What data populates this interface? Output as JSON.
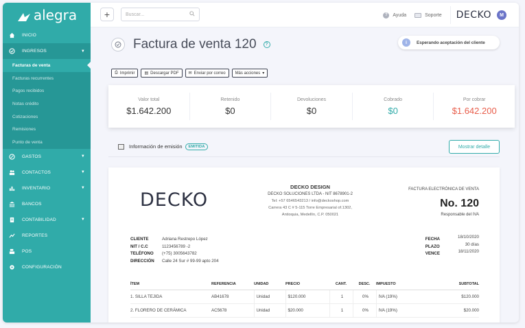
{
  "sidebar": {
    "logo": "alegra",
    "items": [
      {
        "label": "INICIO"
      },
      {
        "label": "INGRESOS"
      },
      {
        "label": "GASTOS"
      },
      {
        "label": "CONTACTOS"
      },
      {
        "label": "INVENTARIO"
      },
      {
        "label": "BANCOS"
      },
      {
        "label": "CONTABILIDAD"
      },
      {
        "label": "REPORTES"
      },
      {
        "label": "POS"
      },
      {
        "label": "CONFIGURACIÓN"
      }
    ],
    "ingresos_sub": [
      "Facturas de venta",
      "Facturas recurrentes",
      "Pagos recibidos",
      "Notas crédito",
      "Cotizaciones",
      "Remisiones",
      "Punto de venta"
    ]
  },
  "topbar": {
    "search_placeholder": "Buscar...",
    "help": "Ayuda",
    "support": "Soporte",
    "brand": "DECKO",
    "avatar": "M"
  },
  "page": {
    "title": "Factura de venta 120",
    "status": "Esperando aceptación del cliente",
    "actions": [
      "Imprimir",
      "Descargar PDF",
      "Enviar por correo",
      "Más acciones"
    ]
  },
  "totals": [
    {
      "label": "Valor total",
      "value": "$1.642.200"
    },
    {
      "label": "Retenido",
      "value": "$0"
    },
    {
      "label": "Devoluciones",
      "value": "$0"
    },
    {
      "label": "Cobrado",
      "value": "$0"
    },
    {
      "label": "Por cobrar",
      "value": "$1.642.200"
    }
  ],
  "emision": {
    "label": "Información de emisión",
    "badge": "EMITIDA",
    "detail_button": "Mostrar detalle"
  },
  "invoice": {
    "logo": "DECKO",
    "company_name": "DECKO DESIGN",
    "company_nit": "DECKO SOLUCIONES LTDA - NIT 8678901-2",
    "company_tel": "Tel: +57 6546543213 / info@deckoshop.com",
    "company_address": "Carrera 43 C # 5-115 Torre Empresarial of.1302,",
    "company_city": "Antioquia, Medellín, C.P. 050021",
    "type": "FACTURA ELECTRÓNICA DE VENTA",
    "number": "No. 120",
    "iva": "Responsable del IVA",
    "client_labels": [
      "CLIENTE",
      "NIT / C.C",
      "TELÉFONO",
      "DIRECCIÓN"
    ],
    "client_values": [
      "Adriana Restrepo López",
      "1123456789 -2",
      "(+75) 3005643782",
      "Calle 24 Sur # 99-99 apto 204"
    ],
    "date_labels": [
      "FECHA",
      "PLAZO",
      "VENCE"
    ],
    "date_values": [
      "18/10/2020",
      "30 días",
      "18/11/2020"
    ],
    "columns": [
      "ÍTEM",
      "REFERENCIA",
      "UNIDAD",
      "PRECIO",
      "CANT.",
      "DESC.",
      "IMPUESTO",
      "SUBTOTAL"
    ],
    "rows": [
      {
        "item": "1.     SILLA TEJIDA",
        "ref": "AB41678",
        "unit": "Unidad",
        "price": "$120.000",
        "qty": "1",
        "desc": "0%",
        "tax": "IVA (19%)",
        "subtotal": "$120.000"
      },
      {
        "item": "2.     FLORERO DE CERÁMICA",
        "ref": "AC5678",
        "unit": "Unidad",
        "price": "$20.000",
        "qty": "1",
        "desc": "0%",
        "tax": "IVA (19%)",
        "subtotal": "$20.000"
      }
    ]
  },
  "colors": {
    "sidebar": "#30aba9",
    "sidebar_active": "#269796",
    "accent": "#30aba9",
    "danger": "#e85d4a"
  }
}
